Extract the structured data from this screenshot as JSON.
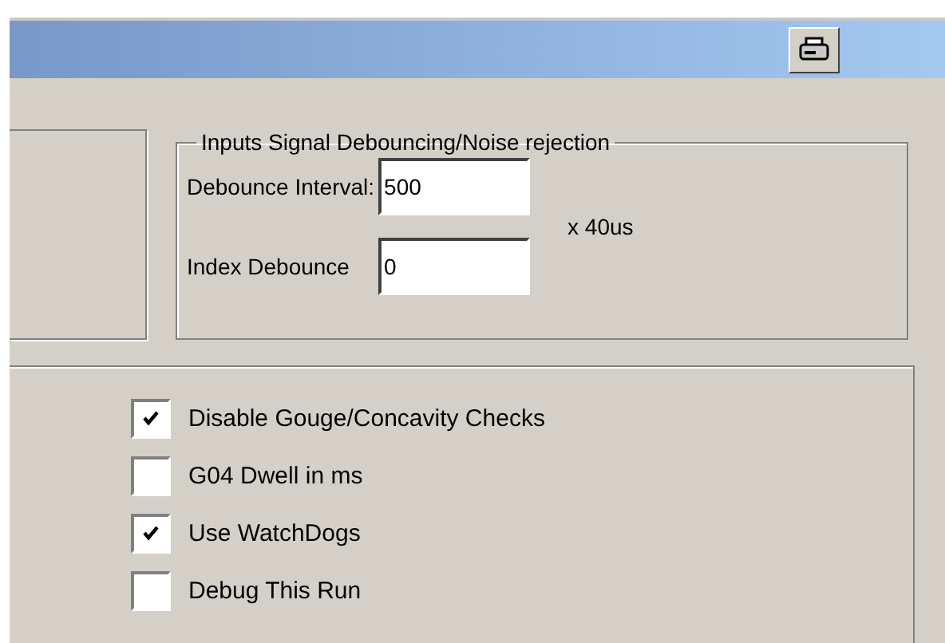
{
  "debounce_group": {
    "title": "Inputs Signal Debouncing/Noise rejection",
    "fields": [
      {
        "label": "Debounce Interval:",
        "value": "500"
      },
      {
        "label": "Index Debounce",
        "value": "0"
      }
    ],
    "unit": "x 40us"
  },
  "options": [
    {
      "label": "Disable Gouge/Concavity Checks",
      "checked": true
    },
    {
      "label": "G04 Dwell in ms",
      "checked": false
    },
    {
      "label": "Use WatchDogs",
      "checked": true
    },
    {
      "label": "Debug This Run",
      "checked": false
    }
  ]
}
